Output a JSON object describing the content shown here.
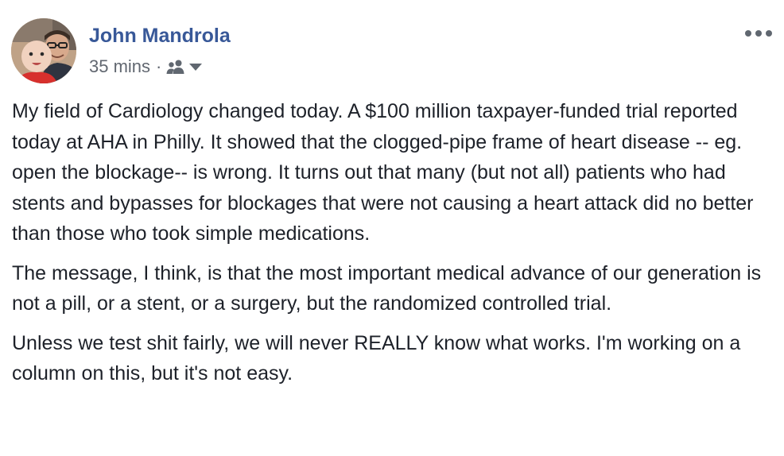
{
  "post": {
    "author": "John Mandrola",
    "timestamp": "35 mins",
    "separator": "·",
    "audience_icon": "friends-icon",
    "dropdown_icon": "caret-down-icon",
    "more_icon": "more-options-icon",
    "paragraphs": [
      "My field of Cardiology changed today. A $100 million taxpayer-funded trial reported today at AHA in Philly. It showed that the clogged-pipe frame of heart disease -- eg. open the blockage-- is wrong. It turns out that many (but not all) patients who had stents and bypasses for blockages that were not causing a heart attack did no better than those who took simple medications.",
      "The message, I think, is that the most important medical advance of our generation is not a pill, or a stent, or a surgery, but the randomized controlled trial.",
      "Unless we test shit fairly, we will never REALLY know what works. I'm working on a column on this, but it's not easy."
    ]
  },
  "colors": {
    "author_link": "#385898",
    "body_text": "#1d2129",
    "meta_text": "#616770",
    "icon_gray": "#606770"
  }
}
